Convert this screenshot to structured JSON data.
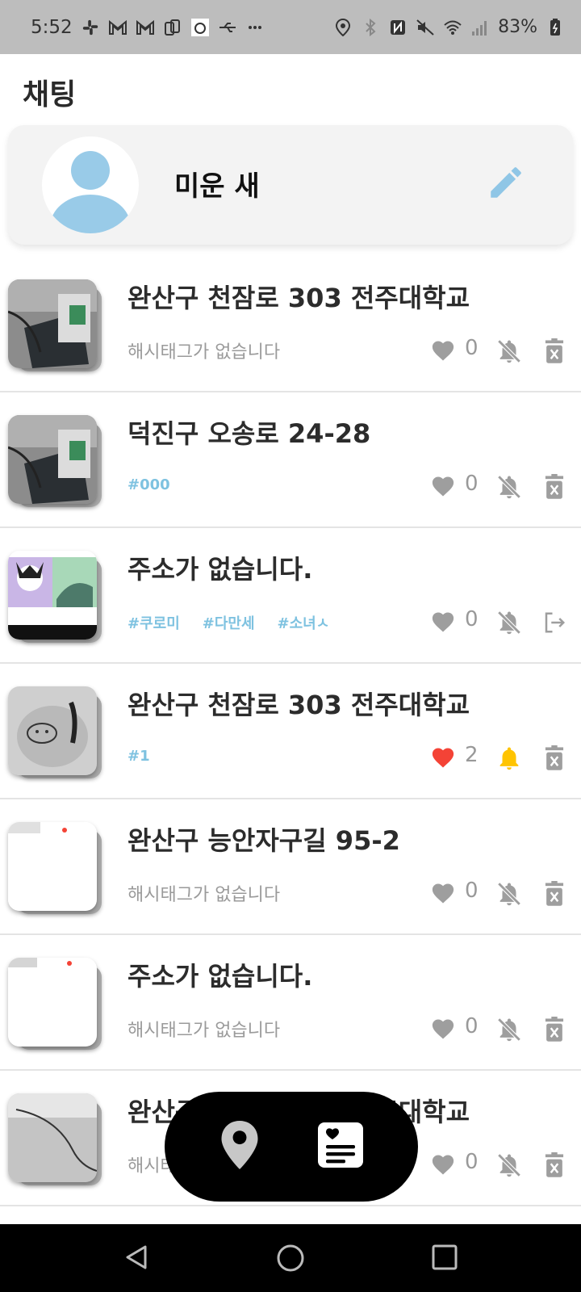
{
  "status_bar": {
    "time": "5:52",
    "battery": "83%",
    "left_icons": [
      "slack-icon",
      "gmail-icon",
      "gmail-icon",
      "copy-icon",
      "app-icon",
      "usb-icon",
      "more-icon"
    ],
    "right_icons": [
      "location-icon",
      "bluetooth-icon",
      "nfc-icon",
      "mute-icon",
      "wifi-icon",
      "signal-icon",
      "battery-icon"
    ]
  },
  "header": {
    "title": "채팅"
  },
  "profile": {
    "name": "미운 새",
    "edit_icon": "pencil-icon",
    "accent": "#8fc6e6"
  },
  "chats": [
    {
      "address": "완산구 천잠로 303 전주대학교",
      "hashtags": [],
      "no_hashtag_text": "해시태그가 없습니다",
      "likes": "0",
      "liked": false,
      "bell": "off",
      "action": "delete",
      "thumb": "laptop"
    },
    {
      "address": "덕진구 오송로 24-28",
      "hashtags": [
        "#000"
      ],
      "no_hashtag_text": "",
      "likes": "0",
      "liked": false,
      "bell": "off",
      "action": "delete",
      "thumb": "laptop"
    },
    {
      "address": "주소가 없습니다.",
      "hashtags": [
        "#쿠로미",
        "#다만세",
        "#소녀ㅅ"
      ],
      "no_hashtag_text": "",
      "likes": "0",
      "liked": false,
      "bell": "off",
      "action": "exit",
      "thumb": "cartoon"
    },
    {
      "address": "완산구 천잠로 303 전주대학교",
      "hashtags": [
        "#1"
      ],
      "no_hashtag_text": "",
      "likes": "2",
      "liked": true,
      "bell": "on",
      "action": "delete",
      "thumb": "pouch"
    },
    {
      "address": "완산구 능안자구길 95-2",
      "hashtags": [],
      "no_hashtag_text": "해시태그가 없습니다",
      "likes": "0",
      "liked": false,
      "bell": "off",
      "action": "delete",
      "thumb": "white-stack"
    },
    {
      "address": "주소가 없습니다.",
      "hashtags": [],
      "no_hashtag_text": "해시태그가 없습니다",
      "likes": "0",
      "liked": false,
      "bell": "off",
      "action": "delete",
      "thumb": "white"
    },
    {
      "address": "완산구 천잠로 303 전주대학교",
      "hashtags": [],
      "no_hashtag_text": "해시태그가 없습니다",
      "likes": "0",
      "liked": false,
      "bell": "off",
      "action": "delete",
      "thumb": "cable"
    }
  ],
  "floating_nav": {
    "items": [
      "map-pin-icon",
      "feed-heart-icon"
    ]
  },
  "colors": {
    "hashtag": "#7ec2e0",
    "liked_heart": "#f44336",
    "bell_on": "#ffc400",
    "icon_gray": "#9e9e9e"
  }
}
